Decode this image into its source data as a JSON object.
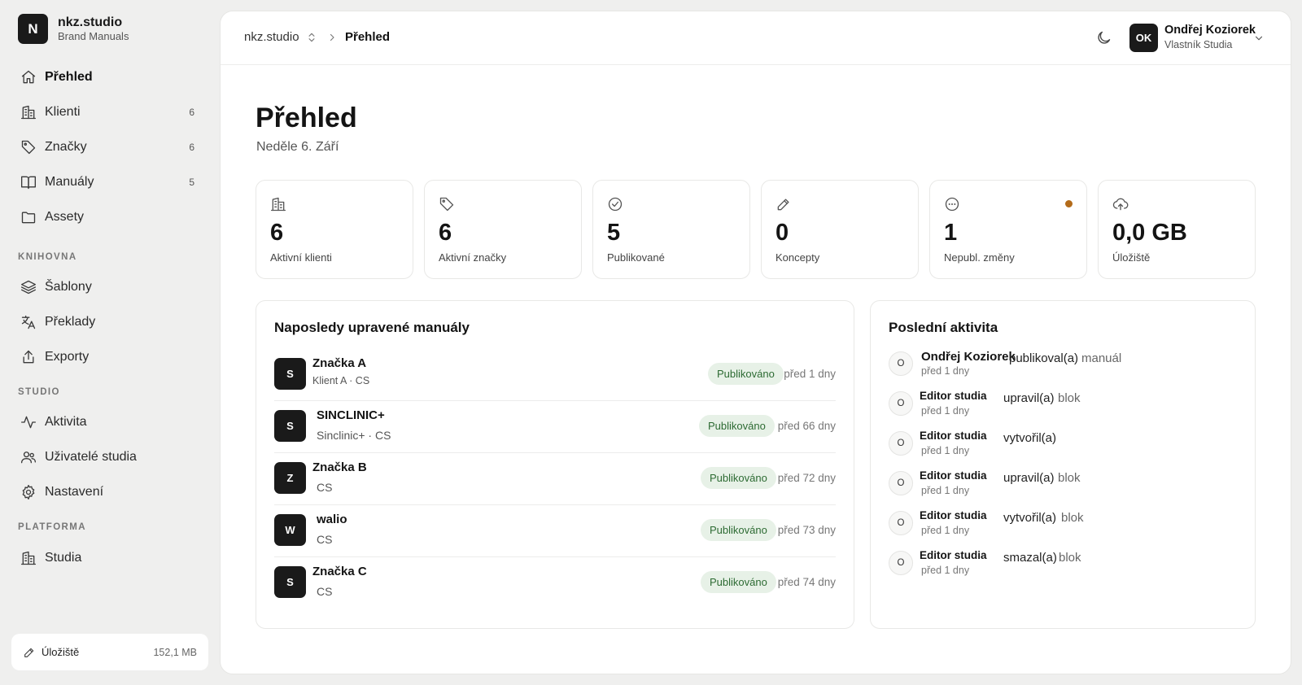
{
  "brand": {
    "initial": "N",
    "name": "nkz.studio",
    "subtitle": "Brand Manuals"
  },
  "sidebar": {
    "main_items": [
      {
        "label": "Přehled",
        "icon": "home-icon",
        "count": ""
      },
      {
        "label": "Klienti",
        "icon": "building-icon",
        "count": "6"
      },
      {
        "label": "Značky",
        "icon": "tag-icon",
        "count": "6"
      },
      {
        "label": "Manuály",
        "icon": "book-icon",
        "count": "5"
      },
      {
        "label": "Assety",
        "icon": "folder-icon",
        "count": ""
      }
    ],
    "sections": {
      "library": "KNIHOVNA",
      "studio": "STUDIO",
      "platform": "PLATFORMA"
    },
    "library_items": [
      {
        "label": "Šablony",
        "icon": "layers-icon"
      },
      {
        "label": "Překlady",
        "icon": "languages-icon"
      },
      {
        "label": "Exporty",
        "icon": "export-icon"
      }
    ],
    "studio_items": [
      {
        "label": "Aktivita",
        "icon": "activity-icon"
      },
      {
        "label": "Uživatelé studia",
        "icon": "users-icon"
      },
      {
        "label": "Nastavení",
        "icon": "gear-icon"
      }
    ],
    "platform_items": [
      {
        "label": "Studia",
        "icon": "building-icon"
      }
    ],
    "storage": {
      "label": "Úložiště",
      "value": "152,1 MB"
    }
  },
  "topbar": {
    "breadcrumb_studio": "nkz.studio",
    "breadcrumb_current": "Přehled",
    "user": {
      "initials": "OK",
      "name": "Ondřej Koziorek",
      "role": "Vlastník Studia"
    }
  },
  "page": {
    "title": "Přehled",
    "date": "Neděle 6. Září"
  },
  "stats": [
    {
      "value": "6",
      "label": "Aktivní klienti",
      "icon": "building-icon"
    },
    {
      "value": "6",
      "label": "Aktivní značky",
      "icon": "tag-icon"
    },
    {
      "value": "5",
      "label": "Publikované",
      "icon": "check-circle-icon"
    },
    {
      "value": "0",
      "label": "Koncepty",
      "icon": "pencil-icon"
    },
    {
      "value": "1",
      "label": "Nepubl. změny",
      "icon": "dots-circle-icon"
    },
    {
      "value": "0,0 GB",
      "label": "Úložiště",
      "icon": "cloud-upload-icon"
    }
  ],
  "recent_manuals": {
    "title": "Naposledy upravené manuály",
    "items": [
      {
        "initial": "S",
        "name": "Značka A",
        "sub": "Klient A · CS",
        "status": "Publikováno",
        "time": "před 1 dny"
      },
      {
        "initial": "S",
        "name": "SINCLINIC+",
        "sub": "Sinclinic+ · CS",
        "status": "Publikováno",
        "time": "před 66 dny"
      },
      {
        "initial": "Z",
        "name": "Značka B",
        "sub": "CS",
        "status": "Publikováno",
        "time": "před 72 dny"
      },
      {
        "initial": "W",
        "name": "walio",
        "sub": "CS",
        "status": "Publikováno",
        "time": "před 73 dny"
      },
      {
        "initial": "S",
        "name": "Značka C",
        "sub": "CS",
        "status": "Publikováno",
        "time": "před 74 dny"
      }
    ]
  },
  "activity": {
    "title": "Poslední aktivita",
    "items": [
      {
        "initial": "O",
        "actor": "Ondřej Koziorek",
        "verb": "publikoval(a)",
        "object": "manuál",
        "time": "před 1 dny"
      },
      {
        "initial": "O",
        "actor": "Editor studia",
        "verb": "upravil(a)",
        "object": "blok",
        "time": "před 1 dny"
      },
      {
        "initial": "O",
        "actor": "Editor studia",
        "verb": "vytvořil(a)",
        "object": "",
        "time": "před 1 dny"
      },
      {
        "initial": "O",
        "actor": "Editor studia",
        "verb": "upravil(a)",
        "object": "blok",
        "time": "před 1 dny"
      },
      {
        "initial": "O",
        "actor": "Editor studia",
        "verb": "vytvořil(a)",
        "object": "blok",
        "time": "před 1 dny"
      },
      {
        "initial": "O",
        "actor": "Editor studia",
        "verb": "smazal(a)",
        "object": "blok",
        "time": "před 1 dny"
      }
    ]
  }
}
